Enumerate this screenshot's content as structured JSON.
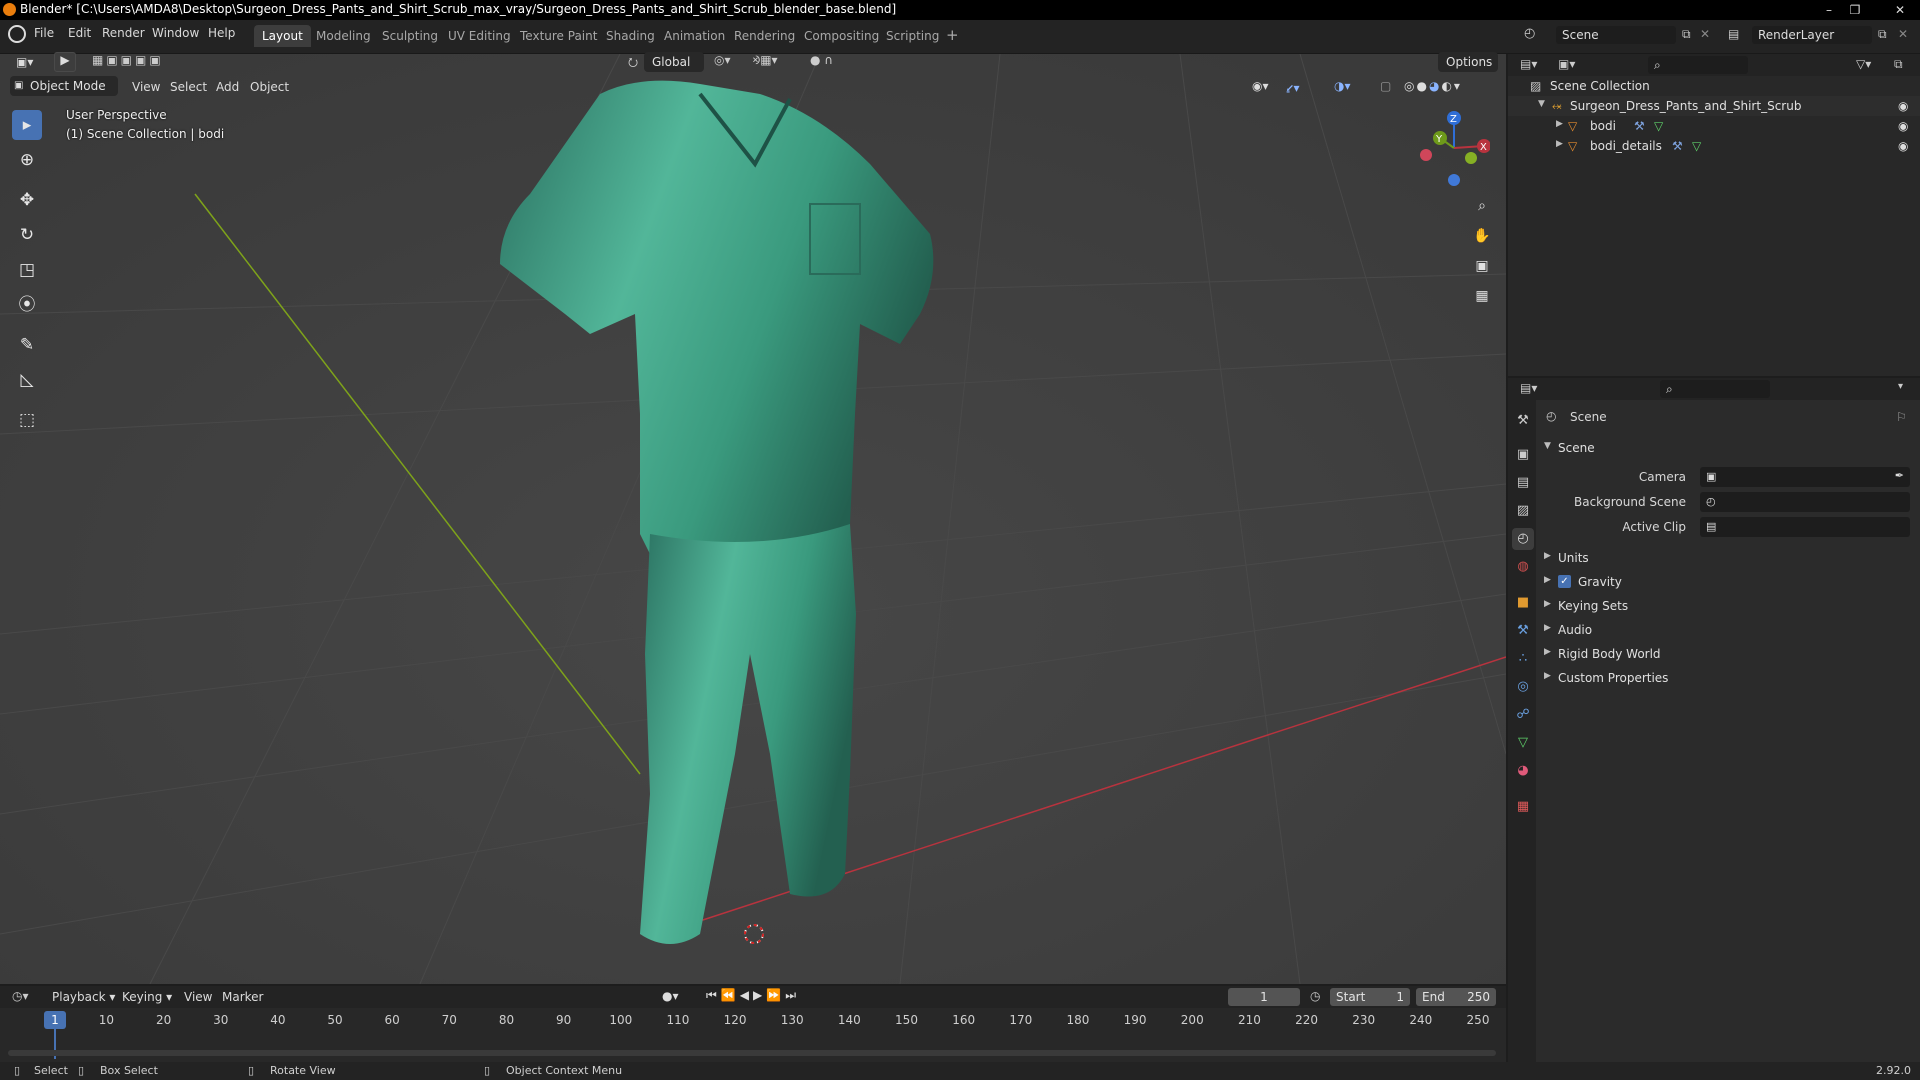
{
  "window": {
    "title": "Blender* [C:\\Users\\AMDA8\\Desktop\\Surgeon_Dress_Pants_and_Shirt_Scrub_max_vray/Surgeon_Dress_Pants_and_Shirt_Scrub_blender_base.blend]"
  },
  "menu": [
    "File",
    "Edit",
    "Render",
    "Window",
    "Help"
  ],
  "workspaces": [
    "Layout",
    "Modeling",
    "Sculpting",
    "UV Editing",
    "Texture Paint",
    "Shading",
    "Animation",
    "Rendering",
    "Compositing",
    "Scripting"
  ],
  "scene_field": "Scene",
  "render_layer": "RenderLayer",
  "viewport": {
    "transform_orientation": "Global",
    "options_label": "Options",
    "mode": "Object Mode",
    "header_menu": [
      "View",
      "Select",
      "Add",
      "Object"
    ],
    "perspective": "User Perspective",
    "collection_info": "(1) Scene Collection | bodi",
    "gizmo": {
      "z": "Z",
      "y": "Y",
      "x": "X"
    },
    "colors": {
      "bg": "#3d3d3d",
      "cloth": "#3f9d85",
      "x_axis": "#b8333e",
      "y_axis": "#7ea31a"
    }
  },
  "outliner": {
    "root": "Scene Collection",
    "collection": "Surgeon_Dress_Pants_and_Shirt_Scrub",
    "objects": [
      "bodi",
      "bodi_details"
    ]
  },
  "properties": {
    "header": "Scene",
    "section": "Scene",
    "fields": [
      {
        "label": "Camera",
        "value": ""
      },
      {
        "label": "Background Scene",
        "value": ""
      },
      {
        "label": "Active Clip",
        "value": ""
      }
    ],
    "panels": [
      {
        "label": "Units",
        "checkbox": false
      },
      {
        "label": "Gravity",
        "checkbox": true
      },
      {
        "label": "Keying Sets",
        "checkbox": false
      },
      {
        "label": "Audio",
        "checkbox": false
      },
      {
        "label": "Rigid Body World",
        "checkbox": false
      },
      {
        "label": "Custom Properties",
        "checkbox": false
      }
    ]
  },
  "timeline": {
    "menu": [
      "Playback",
      "Keying",
      "View",
      "Marker"
    ],
    "current_frame": "1",
    "start_label": "Start",
    "start": "1",
    "end_label": "End",
    "end": "250",
    "ticks": [
      "1",
      "10",
      "20",
      "30",
      "40",
      "50",
      "60",
      "70",
      "80",
      "90",
      "100",
      "110",
      "120",
      "130",
      "140",
      "150",
      "160",
      "170",
      "180",
      "190",
      "200",
      "210",
      "220",
      "230",
      "240",
      "250"
    ]
  },
  "status": {
    "select": "Select",
    "box_select": "Box Select",
    "rotate_view": "Rotate View",
    "context_menu": "Object Context Menu",
    "version": "2.92.0"
  }
}
